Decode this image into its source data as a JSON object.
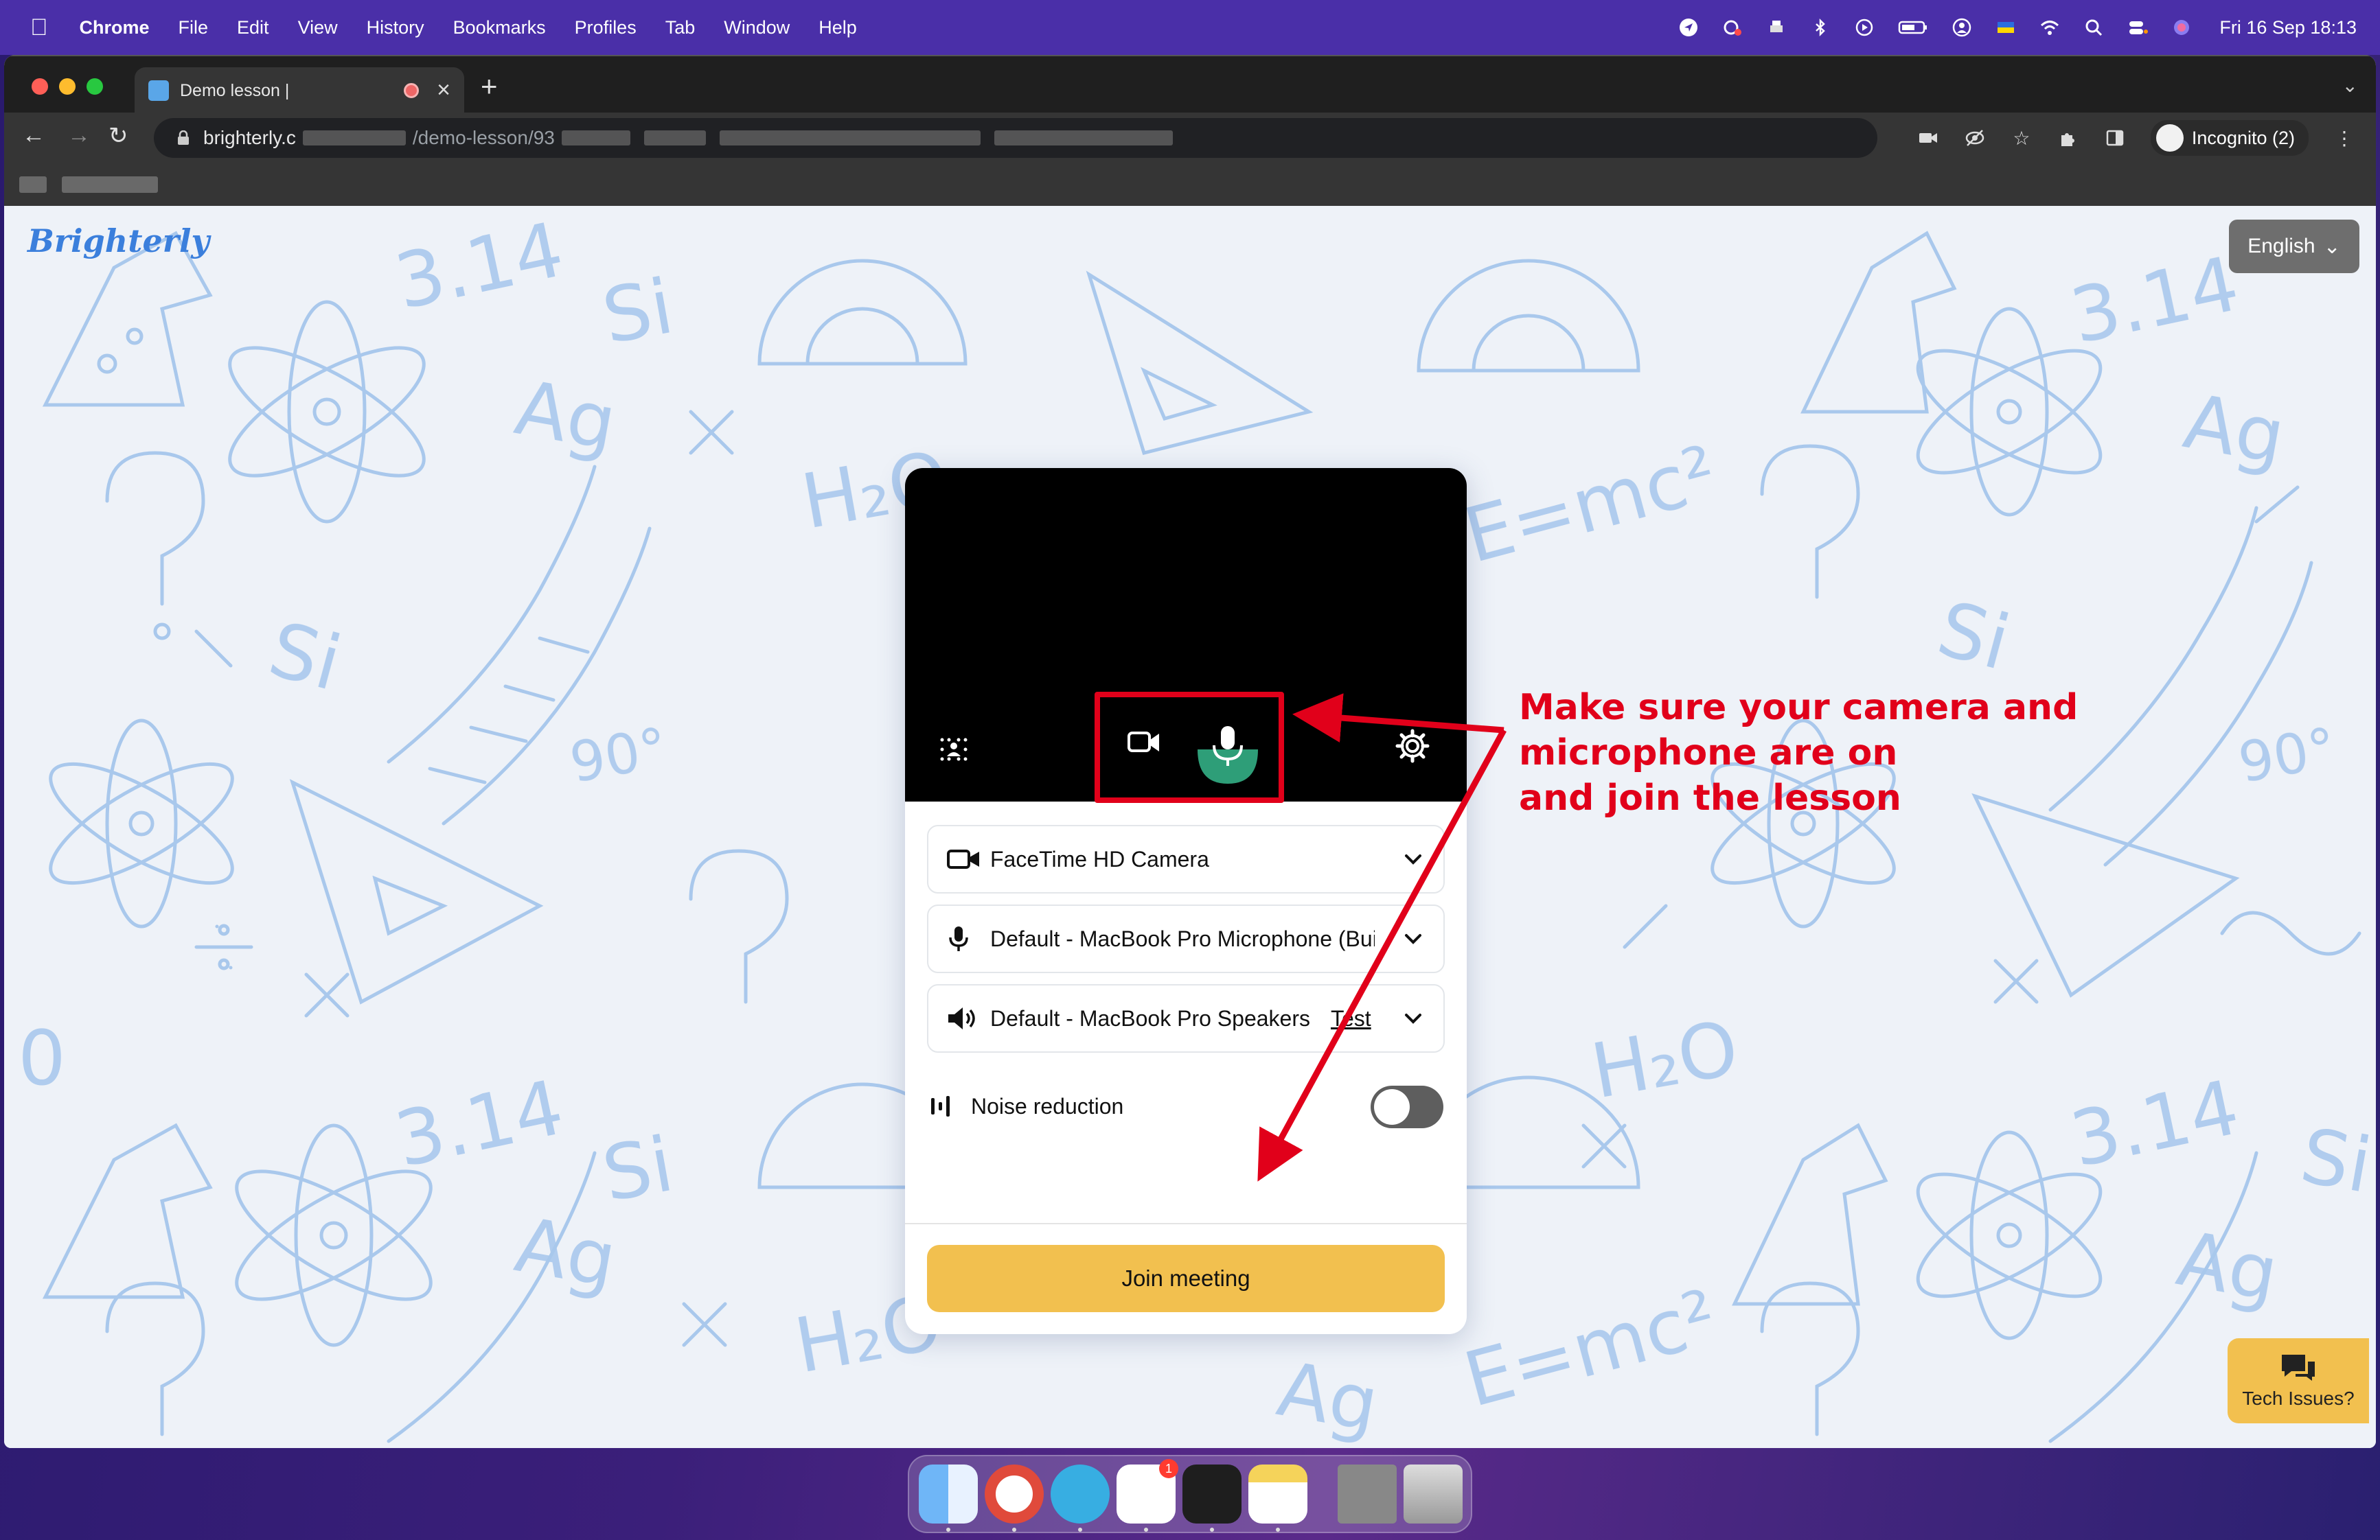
{
  "menubar": {
    "app_name": "Chrome",
    "items": [
      "File",
      "Edit",
      "View",
      "History",
      "Bookmarks",
      "Profiles",
      "Tab",
      "Window",
      "Help"
    ],
    "clock": "Fri 16 Sep  18:13"
  },
  "browser": {
    "tab_title": "Demo lesson |",
    "url_host": "brighterly.c",
    "url_path": "/demo-lesson/93",
    "profile_label": "Incognito (2)"
  },
  "page": {
    "brand": "Brighterly",
    "language_button": "English",
    "tech_issues": "Tech Issues?"
  },
  "prejoin": {
    "camera_device": "FaceTime HD Camera",
    "microphone_device": "Default - MacBook Pro Microphone (Buil",
    "speaker_device": "Default - MacBook Pro Speakers",
    "speaker_test_link": "Test",
    "noise_reduction_label": "Noise reduction",
    "noise_reduction_on": false,
    "join_button": "Join meeting"
  },
  "annotation": {
    "line1": "Make sure your camera and microphone are on",
    "line2": "and join the lesson",
    "color": "#e1001a"
  },
  "colors": {
    "join_button": "#f2c04f",
    "mic_active": "#2e9e78",
    "menubar": "#4a2fa8"
  },
  "dock": {
    "apps": [
      "finder-icon",
      "chrome-icon",
      "telegram-icon",
      "slack-icon",
      "figma-icon",
      "notes-icon",
      "screenshot-icon",
      "trash-icon"
    ],
    "slack_badge": "1"
  }
}
